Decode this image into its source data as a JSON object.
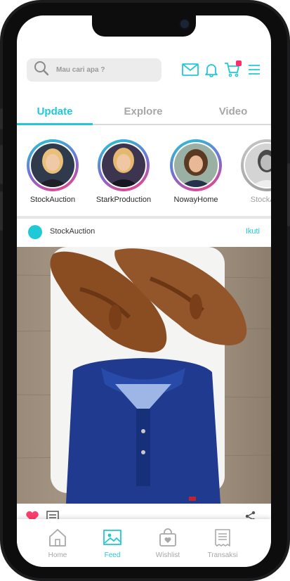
{
  "search": {
    "placeholder": "Mau cari apa ?"
  },
  "header": {
    "icons": [
      "mail-icon",
      "bell-icon",
      "cart-icon",
      "menu-icon"
    ],
    "accent_color": "#21c9d6",
    "badge_color": "#ff2d6d"
  },
  "tabs": [
    {
      "label": "Update",
      "active": true
    },
    {
      "label": "Explore",
      "active": false
    },
    {
      "label": "Video",
      "active": false
    }
  ],
  "stories": [
    {
      "name": "StockAuction"
    },
    {
      "name": "StarkProduction"
    },
    {
      "name": "NowayHome"
    },
    {
      "name": "StockAuc"
    }
  ],
  "post": {
    "username": "StockAuction",
    "follow_label": "Ikuti"
  },
  "bottom_nav": [
    {
      "label": "Home",
      "icon": "home-icon",
      "active": false
    },
    {
      "label": "Feed",
      "icon": "image-icon",
      "active": true
    },
    {
      "label": "Wishlist",
      "icon": "bag-icon",
      "active": false
    },
    {
      "label": "Transaksi",
      "icon": "receipt-icon",
      "active": false
    }
  ]
}
